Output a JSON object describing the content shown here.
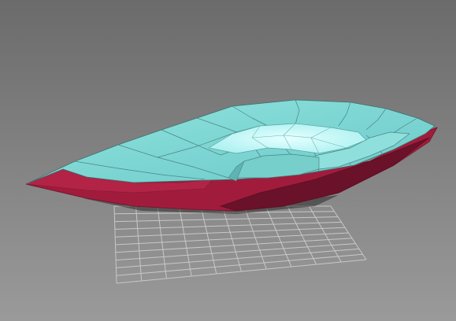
{
  "viewport": {
    "background_top": "#6b6b6b",
    "background_bottom": "#9a9a9a"
  },
  "grid": {
    "color": "#c8c8c8"
  },
  "model": {
    "top_color": "#7ed9d6",
    "top_highlight_color": "#c9fbfc",
    "rim_color": "#a11c3c",
    "rim_dark_color": "#5f0f24",
    "edge_color": "#3e6f6e"
  }
}
